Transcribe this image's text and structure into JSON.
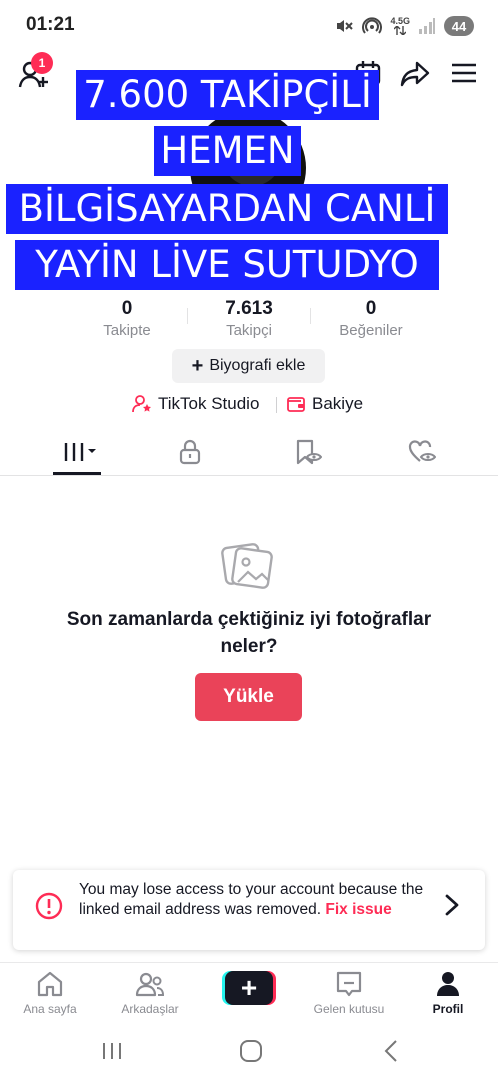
{
  "status_bar": {
    "time": "01:21",
    "network_label_top": "4.5G",
    "battery": "44"
  },
  "header": {
    "notification_count": "1"
  },
  "banner": {
    "lines": [
      "7.600 TAKİPÇİLİ",
      "HEMEN",
      "BİLGİSAYARDAN CANLİ",
      "YAYİN LİVE SUTUDYO"
    ],
    "color": "#1a22ff"
  },
  "stats": [
    {
      "value": "0",
      "label": "Takipte"
    },
    {
      "value": "7.613",
      "label": "Takipçi"
    },
    {
      "value": "0",
      "label": "Beğeniler"
    }
  ],
  "profile": {
    "bio_button": "Biyografi ekle",
    "studio_link": "TikTok Studio",
    "balance_link": "Bakiye"
  },
  "tabs": [
    {
      "icon": "grid-icon",
      "active": true
    },
    {
      "icon": "lock-icon",
      "active": false
    },
    {
      "icon": "bookmark-eye-icon",
      "active": false
    },
    {
      "icon": "heart-eye-icon",
      "active": false
    }
  ],
  "empty_state": {
    "text": "Son zamanlarda çektiğiniz iyi fotoğraflar neler?",
    "upload_button": "Yükle"
  },
  "warning": {
    "message": "You may lose access to your account because the linked email address was removed.",
    "action": "Fix issue"
  },
  "bottom_nav": [
    {
      "label": "Ana sayfa",
      "icon": "home-icon",
      "active": false
    },
    {
      "label": "Arkadaşlar",
      "icon": "friends-icon",
      "active": false
    },
    {
      "label": "",
      "icon": "create-icon",
      "active": false
    },
    {
      "label": "Gelen kutusu",
      "icon": "inbox-icon",
      "active": false
    },
    {
      "label": "Profil",
      "icon": "profile-icon",
      "active": true
    }
  ],
  "colors": {
    "accent": "#fe2c55",
    "upload_button": "#ea4359",
    "text_primary": "#161823",
    "text_secondary": "#8a8b91"
  }
}
